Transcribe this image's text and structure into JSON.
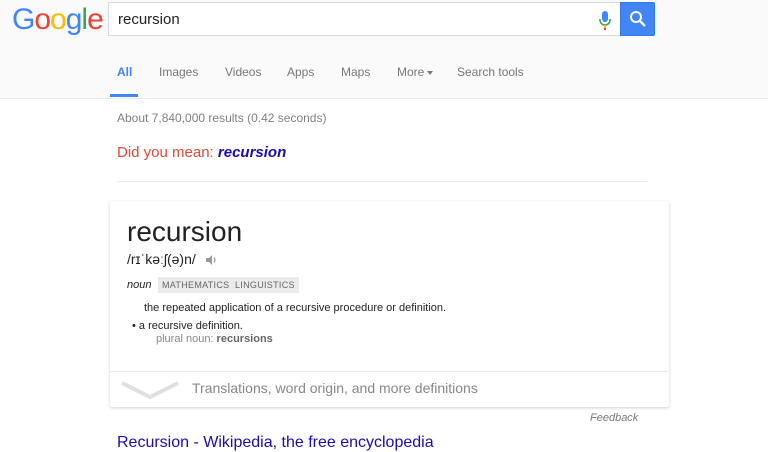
{
  "header": {
    "logo": {
      "letters": [
        "G",
        "o",
        "o",
        "g",
        "l",
        "e"
      ],
      "colors": [
        "#4285f4",
        "#ea4335",
        "#fbbc05",
        "#4285f4",
        "#34a853",
        "#ea4335"
      ]
    },
    "search": {
      "value": "recursion"
    },
    "accent": "#4285f4"
  },
  "tabs": [
    {
      "label": "All"
    },
    {
      "label": "Images"
    },
    {
      "label": "Videos"
    },
    {
      "label": "Apps"
    },
    {
      "label": "Maps"
    },
    {
      "label": "More"
    },
    {
      "label": "Search tools"
    }
  ],
  "results": {
    "stats": "About 7,840,000 results (0.42 seconds)",
    "did_you_mean_prefix": "Did you mean: ",
    "did_you_mean_link": "recursion"
  },
  "definition": {
    "word": "recursion",
    "pronunciation": "/rɪˈkəːʃ(ə)n/",
    "part_of_speech": "noun",
    "tags": [
      "MATHEMATICS",
      "LINGUISTICS"
    ],
    "definition": "the repeated application of a recursive procedure or definition.",
    "bullet": "a recursive definition.",
    "plural_prefix": "plural noun: ",
    "plural_word": "recursions",
    "more_link": "Translations, word origin, and more definitions",
    "feedback": "Feedback"
  },
  "next_result": {
    "title": "Recursion - Wikipedia, the free encyclopedia"
  }
}
